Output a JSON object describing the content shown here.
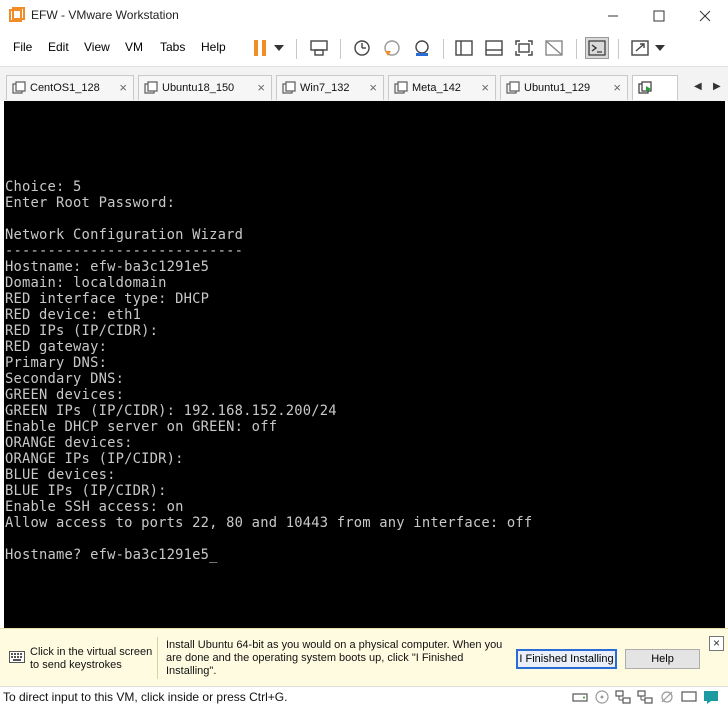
{
  "window": {
    "title": "EFW - VMware Workstation"
  },
  "menu": {
    "items": [
      "File",
      "Edit",
      "View",
      "VM",
      "Tabs",
      "Help"
    ]
  },
  "toolbar": {
    "icons": [
      "pause-icon",
      "dropdown-icon",
      "send-ctrl-alt-del-icon",
      "snapshot-icon",
      "revert-snapshot-icon",
      "snapshot-manager-icon",
      "library-icon",
      "thumbnail-bar-icon",
      "fullscreen-icon",
      "unity-icon",
      "console-view-icon",
      "stretch-icon"
    ]
  },
  "tabs": [
    {
      "label": "CentOS1_128"
    },
    {
      "label": "Ubuntu18_150"
    },
    {
      "label": "Win7_132"
    },
    {
      "label": "Meta_142"
    },
    {
      "label": "Ubuntu1_129"
    }
  ],
  "console": {
    "lines": [
      "Choice: 5",
      "Enter Root Password:",
      "",
      "Network Configuration Wizard",
      "----------------------------",
      "Hostname: efw-ba3c1291e5",
      "Domain: localdomain",
      "RED interface type: DHCP",
      "RED device: eth1",
      "RED IPs (IP/CIDR):",
      "RED gateway:",
      "Primary DNS:",
      "Secondary DNS:",
      "GREEN devices:",
      "GREEN IPs (IP/CIDR): 192.168.152.200/24",
      "Enable DHCP server on GREEN: off",
      "ORANGE devices:",
      "ORANGE IPs (IP/CIDR):",
      "BLUE devices:",
      "BLUE IPs (IP/CIDR):",
      "Enable SSH access: on",
      "Allow access to ports 22, 80 and 10443 from any interface: off",
      "",
      "Hostname? efw-ba3c1291e5_"
    ]
  },
  "hint": {
    "left_text": "Click in the virtual screen to send keystrokes",
    "main_text": "Install Ubuntu 64-bit as you would on a physical computer. When you are done and the operating system boots up, click \"I Finished Installing\".",
    "finished_button": "I Finished Installing",
    "help_button": "Help"
  },
  "status": {
    "text": "To direct input to this VM, click inside or press Ctrl+G."
  },
  "colors": {
    "accent_orange": "#f28c28",
    "console_bg": "#000000",
    "console_fg": "#c8c8c8",
    "hint_bg": "#fffbe1"
  }
}
